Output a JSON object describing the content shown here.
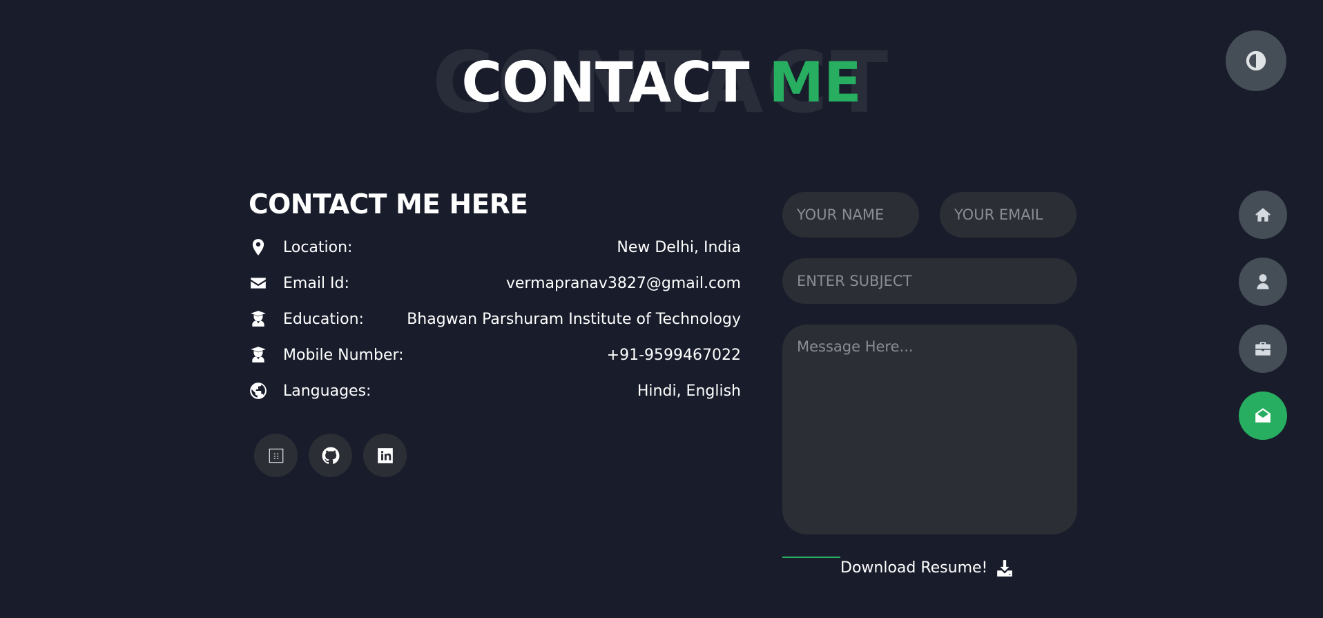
{
  "header": {
    "background_text": "CONTACT",
    "title_main": "CONTACT",
    "title_accent": "ME",
    "accent_color": "#27ae60"
  },
  "info": {
    "heading": "CONTACT ME HERE",
    "rows": [
      {
        "icon": "map-pin-icon",
        "label": "Location:",
        "value": "New Delhi, India"
      },
      {
        "icon": "envelope-icon",
        "label": "Email Id:",
        "value": "vermapranav3827@gmail.com"
      },
      {
        "icon": "graduate-icon",
        "label": "Education:",
        "value": "Bhagwan Parshuram Institute of Technology"
      },
      {
        "icon": "graduate-icon",
        "label": "Mobile Number:",
        "value": "+91-9599467022"
      },
      {
        "icon": "globe-icon",
        "label": "Languages:",
        "value": "Hindi, English"
      }
    ]
  },
  "socials": [
    {
      "icon": "broken-image-icon"
    },
    {
      "icon": "github-icon"
    },
    {
      "icon": "linkedin-icon"
    }
  ],
  "form": {
    "name_placeholder": "YOUR NAME",
    "email_placeholder": "YOUR EMAIL",
    "subject_placeholder": "ENTER SUBJECT",
    "message_placeholder": "Message Here..."
  },
  "download": {
    "label": "Download Resume!",
    "icon": "download-icon"
  },
  "controls": {
    "theme_icon": "contrast-icon",
    "nav": [
      {
        "icon": "home-icon",
        "active": false
      },
      {
        "icon": "user-icon",
        "active": false
      },
      {
        "icon": "briefcase-icon",
        "active": false
      },
      {
        "icon": "envelope-open-icon",
        "active": true
      }
    ],
    "button_color": "#454e56",
    "active_color": "#27ae60"
  },
  "colors": {
    "background": "#191d2b",
    "field": "#2b2e35"
  }
}
